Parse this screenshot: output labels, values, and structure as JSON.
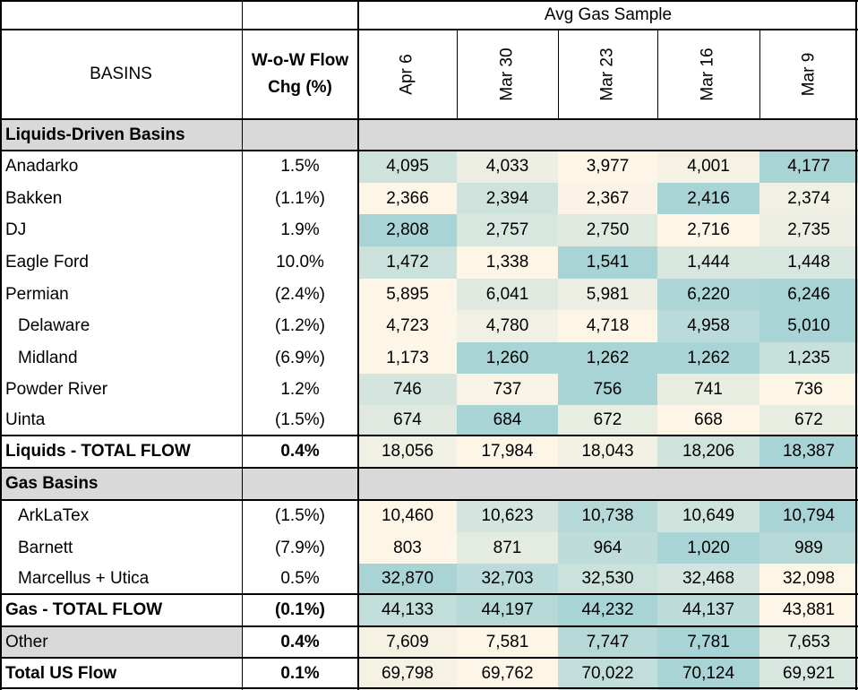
{
  "header": {
    "group_title": "Avg Gas Sample",
    "col_basins": "BASINS",
    "col_change_line1": "W-o-W Flow",
    "col_change_line2": "Chg (%)",
    "dates": [
      "Apr 6",
      "Mar 30",
      "Mar 23",
      "Mar 16",
      "Mar 9"
    ]
  },
  "colors": {
    "section_gray": "#d9d9d9",
    "heat_low": "#fdf5e6",
    "heat_high": "#a9d4d6"
  },
  "rows": [
    {
      "type": "section",
      "label": "Liquids-Driven Basins"
    },
    {
      "type": "data",
      "label": "Anadarko",
      "indent": 0,
      "change": "1.5%",
      "values": [
        "4,095",
        "4,033",
        "3,977",
        "4,001",
        "4,177"
      ],
      "heat": [
        0.55,
        0.2,
        0.0,
        0.1,
        1.0
      ]
    },
    {
      "type": "data",
      "label": "Bakken",
      "indent": 0,
      "change": "(1.1%)",
      "values": [
        "2,366",
        "2,394",
        "2,367",
        "2,416",
        "2,374"
      ],
      "heat": [
        0.0,
        0.55,
        0.02,
        1.0,
        0.15
      ]
    },
    {
      "type": "data",
      "label": "DJ",
      "indent": 0,
      "change": "1.9%",
      "values": [
        "2,808",
        "2,757",
        "2,750",
        "2,716",
        "2,735"
      ],
      "heat": [
        1.0,
        0.45,
        0.35,
        0.0,
        0.2
      ]
    },
    {
      "type": "data",
      "label": "Eagle Ford",
      "indent": 0,
      "change": "10.0%",
      "values": [
        "1,472",
        "1,338",
        "1,541",
        "1,444",
        "1,448"
      ],
      "heat": [
        0.6,
        0.0,
        1.0,
        0.45,
        0.45
      ]
    },
    {
      "type": "data",
      "label": "Permian",
      "indent": 0,
      "change": "(2.4%)",
      "values": [
        "5,895",
        "6,041",
        "5,981",
        "6,220",
        "6,246"
      ],
      "heat": [
        0.0,
        0.35,
        0.2,
        0.95,
        1.0
      ]
    },
    {
      "type": "data",
      "label": "Delaware",
      "indent": 1,
      "change": "(1.2%)",
      "values": [
        "4,723",
        "4,780",
        "4,718",
        "4,958",
        "5,010"
      ],
      "heat": [
        0.0,
        0.15,
        0.0,
        0.8,
        1.0
      ]
    },
    {
      "type": "data",
      "label": "Midland",
      "indent": 1,
      "change": "(6.9%)",
      "values": [
        "1,173",
        "1,260",
        "1,262",
        "1,262",
        "1,235"
      ],
      "heat": [
        0.0,
        1.0,
        1.0,
        1.0,
        0.65
      ]
    },
    {
      "type": "data",
      "label": "Powder River",
      "indent": 0,
      "change": "1.2%",
      "values": [
        "746",
        "737",
        "756",
        "741",
        "736"
      ],
      "heat": [
        0.5,
        0.05,
        1.0,
        0.25,
        0.0
      ]
    },
    {
      "type": "data",
      "label": "Uinta",
      "indent": 0,
      "change": "(1.5%)",
      "values": [
        "674",
        "684",
        "672",
        "668",
        "672"
      ],
      "heat": [
        0.35,
        1.0,
        0.25,
        0.0,
        0.25
      ]
    },
    {
      "type": "total",
      "label": "Liquids - TOTAL FLOW",
      "change": "0.4%",
      "values": [
        "18,056",
        "17,984",
        "18,043",
        "18,206",
        "18,387"
      ],
      "heat": [
        0.15,
        0.0,
        0.12,
        0.55,
        1.0
      ]
    },
    {
      "type": "section",
      "label": "Gas Basins"
    },
    {
      "type": "data",
      "label": "ArkLaTex",
      "indent": 1,
      "change": "(1.5%)",
      "values": [
        "10,460",
        "10,623",
        "10,738",
        "10,649",
        "10,794"
      ],
      "heat": [
        0.0,
        0.5,
        0.85,
        0.55,
        1.0
      ]
    },
    {
      "type": "data",
      "label": "Barnett",
      "indent": 1,
      "change": "(7.9%)",
      "values": [
        "803",
        "871",
        "964",
        "1,020",
        "989"
      ],
      "heat": [
        0.0,
        0.3,
        0.75,
        1.0,
        0.85
      ]
    },
    {
      "type": "data",
      "label": "Marcellus + Utica",
      "indent": 1,
      "change": "0.5%",
      "values": [
        "32,870",
        "32,703",
        "32,530",
        "32,468",
        "32,098"
      ],
      "heat": [
        1.0,
        0.8,
        0.6,
        0.5,
        0.0
      ]
    },
    {
      "type": "total",
      "label": "Gas - TOTAL FLOW",
      "change": "(0.1%)",
      "values": [
        "44,133",
        "44,197",
        "44,232",
        "44,137",
        "43,881"
      ],
      "heat": [
        0.7,
        0.85,
        1.0,
        0.75,
        0.0
      ]
    },
    {
      "type": "other",
      "label": "Other",
      "change": "0.4%",
      "values": [
        "7,609",
        "7,581",
        "7,747",
        "7,781",
        "7,653"
      ],
      "heat": [
        0.1,
        0.0,
        0.85,
        1.0,
        0.35
      ]
    },
    {
      "type": "total",
      "label": "Total US Flow",
      "change": "0.1%",
      "values": [
        "69,798",
        "69,762",
        "70,022",
        "70,124",
        "69,921"
      ],
      "heat": [
        0.1,
        0.0,
        0.7,
        1.0,
        0.45
      ]
    }
  ]
}
